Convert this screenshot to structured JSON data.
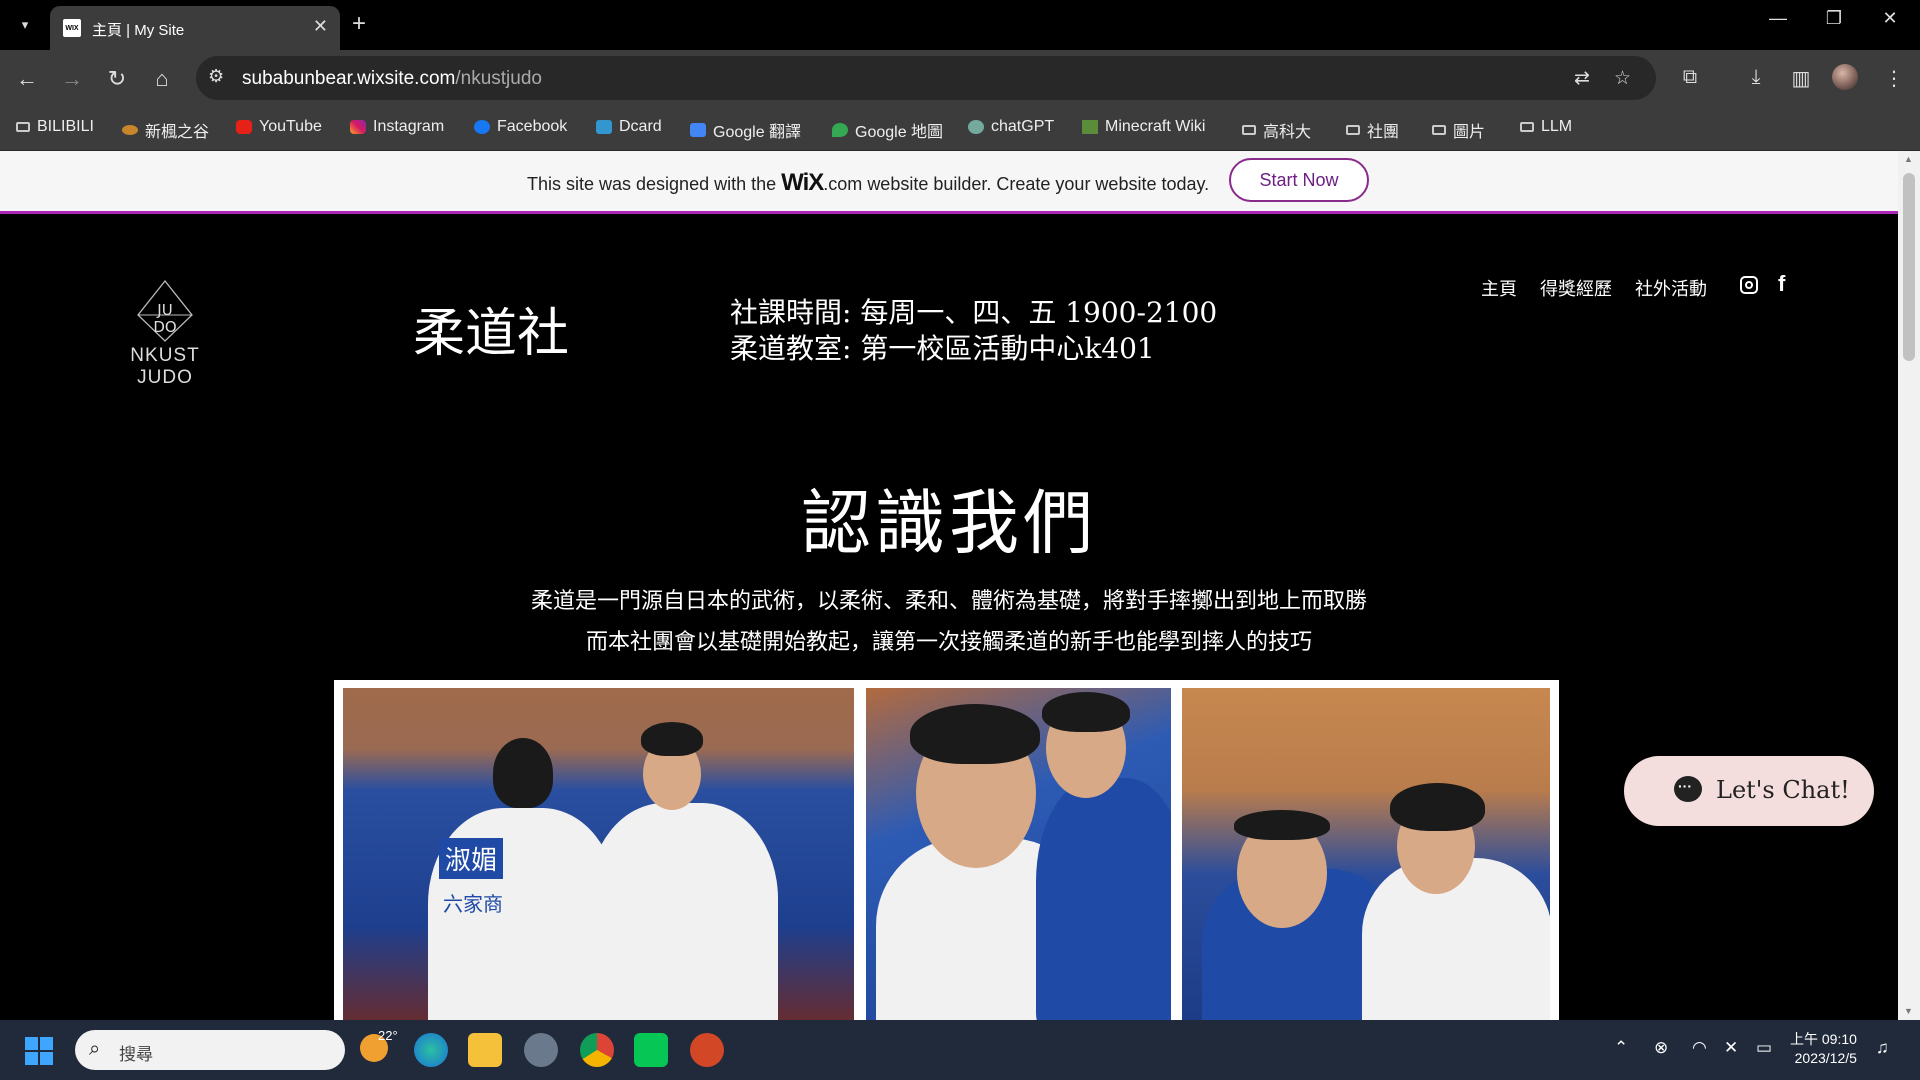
{
  "browser": {
    "tab_title": "主頁 | My Site",
    "tab_favicon": "WIX",
    "url_host": "subabunbear.wixsite.com",
    "url_path": "/nkustjudo",
    "bookmarks": [
      "BILIBILI",
      "新楓之谷",
      "YouTube",
      "Instagram",
      "Facebook",
      "Dcard",
      "Google 翻譯",
      "Google 地圖",
      "chatGPT",
      "Minecraft Wiki",
      "高科大",
      "社團",
      "圖片",
      "LLM"
    ]
  },
  "wix_banner": {
    "text_before": "This site was designed with the",
    "logo": "WiX",
    "logo_suffix": ".com",
    "text_after": "website builder. Create your website today.",
    "button": "Start Now"
  },
  "site": {
    "logo_line1": "JU",
    "logo_line2": "DO",
    "logo_text": "NKUST JUDO",
    "title": "柔道社",
    "info_line1": "社課時間: 每周一、四、五 1900-2100",
    "info_line2": "柔道教室: 第一校區活動中心k401",
    "nav": [
      "主頁",
      "得獎經歷",
      "社外活動"
    ],
    "heading": "認識我們",
    "desc_line1": "柔道是一門源自日本的武術，以柔術、柔和、體術為基礎，將對手摔擲出到地上而取勝",
    "desc_line2": "而本社團會以基礎開始教起，讓第一次接觸柔道的新手也能學到摔人的技巧",
    "photo1_text1": "淑媚",
    "photo1_text2": "六家商",
    "chat_label": "Let's Chat!"
  },
  "taskbar": {
    "search_placeholder": "搜尋",
    "weather_temp": "22°",
    "time": "上午 09:10",
    "date": "2023/12/5"
  },
  "colors": {
    "wix_border": "#b026b9",
    "wix_button_text": "#6d1f84",
    "chat_bg": "#f4dddd"
  }
}
